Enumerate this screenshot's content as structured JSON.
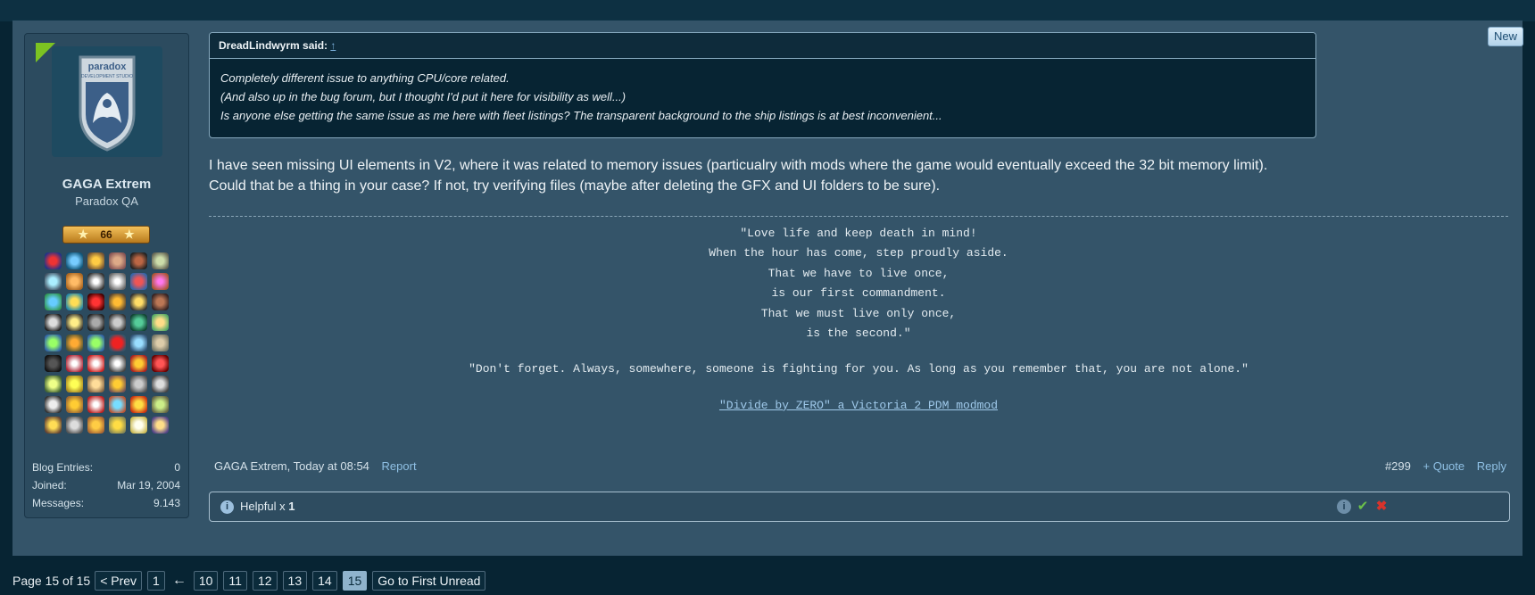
{
  "post": {
    "new_badge": "New",
    "user": {
      "name": "GAGA Extrem",
      "title": "Paradox QA",
      "medal_value": "66",
      "stats": [
        {
          "label": "Blog Entries:",
          "value": "0"
        },
        {
          "label": "Joined:",
          "value": "Mar 19, 2004"
        },
        {
          "label": "Messages:",
          "value": "9.143"
        }
      ]
    },
    "quote": {
      "author": "DreadLindwyrm said:",
      "up_link": "↑",
      "lines": [
        "Completely different issue to anything CPU/core related.",
        "(And also up in the bug forum, but I thought I'd put it here for visibility as well...)",
        "Is anyone else getting the same issue as me here with fleet listings? The transparent background to the ship listings is at best inconvenient..."
      ]
    },
    "message": [
      "I have seen missing UI elements in V2, where it was related to memory issues (particualry with mods where the game would eventually exceed the 32 bit memory limit).",
      "Could that be a thing in your case? If not, try verifying files (maybe after deleting the GFX and UI folders to be sure)."
    ],
    "signature": {
      "poem": [
        "\"Love life and keep death in mind!",
        "When the hour has come, step proudly aside.",
        "That we have to live once,",
        "is our first commandment.",
        "That we must live only once,",
        "is the second.\""
      ],
      "quote": "\"Don't forget. Always, somewhere, someone is fighting for you. As long as you remember that, you are not alone.\"",
      "link": "\"Divide by ZERO\" a Victoria 2 PDM modmod"
    },
    "footer": {
      "meta": "GAGA Extrem, Today at 08:54",
      "report": "Report",
      "number": "#299",
      "quote": "+ Quote",
      "reply": "Reply"
    },
    "helpful": {
      "label": "Helpful x",
      "count": "1"
    }
  },
  "pagination": {
    "label": "Page 15 of 15",
    "prev": "< Prev",
    "first": "1",
    "arrow": "←",
    "pages": [
      "10",
      "11",
      "12",
      "13",
      "14",
      "15"
    ],
    "current": "15",
    "first_unread": "Go to First Unread"
  }
}
